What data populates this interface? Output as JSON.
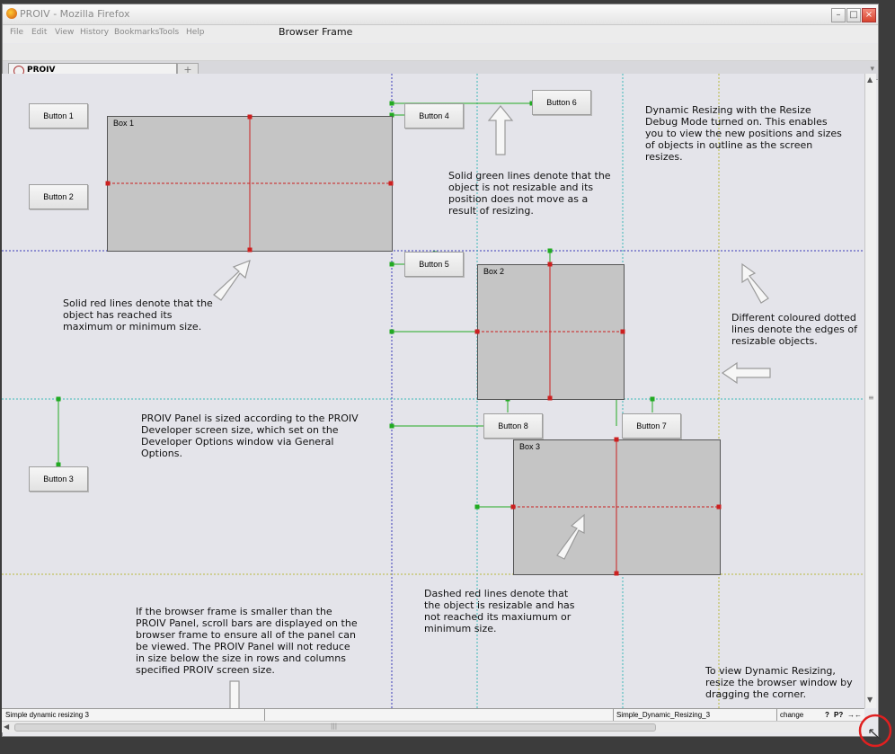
{
  "window": {
    "title": "PROIV - Mozilla Firefox"
  },
  "menu": {
    "items": [
      "File",
      "Edit",
      "View",
      "History",
      "Bookmarks",
      "Tools",
      "Help"
    ]
  },
  "frame_label": "Browser Frame",
  "tab": {
    "label": "PROIV",
    "new_tab_symbol": "+"
  },
  "buttons": {
    "b1": "Button 1",
    "b2": "Button 2",
    "b3": "Button 3",
    "b4": "Button 4",
    "b5": "Button 5",
    "b6": "Button 6",
    "b7": "Button 7",
    "b8": "Button 8"
  },
  "boxes": {
    "box1": "Box 1",
    "box2": "Box 2",
    "box3": "Box 3"
  },
  "notes": {
    "dynamic": "Dynamic Resizing with the Resize\nDebug Mode turned on. This enables\nyou to view the new positions and sizes\nof objects in outline as the screen\nresizes.",
    "green": "Solid green lines denote that the\nobject is not resizable and its\nposition does not move as a\nresult of resizing.",
    "red_solid": "Solid red lines denote that the\nobject has reached its\nmaximum or minimum size.",
    "dotted": "Different coloured dotted\nlines denote the edges of\nresizable objects.",
    "panel": "PROIV Panel is sized according to the PROIV\nDeveloper screen size, which set on the\nDeveloper Options window via General\nOptions.",
    "dashed": "Dashed red lines denote that\nthe object is resizable and has\nnot reached its maxiumum or\nminimum size.",
    "scroll": "If the browser frame is smaller than the\nPROIV Panel, scroll bars are displayed on the\nbrowser frame to ensure all of the panel can\nbe viewed. The PROIV Panel will not reduce\nin size below the size in rows and columns\nspecified PROIV screen size.",
    "corner": "To view Dynamic Resizing,\nresize the browser window by\ndragging the corner."
  },
  "status": {
    "left": "Simple dynamic resizing 3",
    "name": "Simple_Dynamic_Resizing_3",
    "mode": "change",
    "help": "?",
    "p": "P?"
  },
  "colors": {
    "green": "#22aa22",
    "red": "#cc2020",
    "blue_dotted": "#3a3ab8",
    "teal_dotted": "#3cb8b8",
    "olive_dotted": "#b8b83c",
    "box_fill": "#c5c5c5"
  }
}
